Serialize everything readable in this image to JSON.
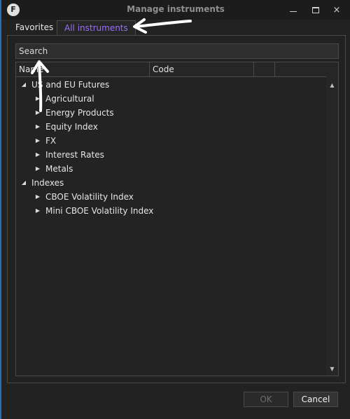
{
  "window": {
    "title": "Manage instruments",
    "controls": {
      "minimize": "minimize-icon",
      "maximize": "maximize-icon",
      "close": "×"
    }
  },
  "tabs": [
    {
      "label": "Favorites",
      "active": false
    },
    {
      "label": "All instruments",
      "active": true,
      "color": "#9b6cff"
    }
  ],
  "search": {
    "placeholder": "Search",
    "value": ""
  },
  "grid": {
    "columns": [
      "Name",
      "Code"
    ],
    "tree": [
      {
        "label": "US and EU Futures",
        "expanded": true,
        "children": [
          {
            "label": "Agricultural"
          },
          {
            "label": "Energy Products"
          },
          {
            "label": "Equity Index"
          },
          {
            "label": "FX"
          },
          {
            "label": "Interest Rates"
          },
          {
            "label": "Metals"
          }
        ]
      },
      {
        "label": "Indexes",
        "expanded": true,
        "children": [
          {
            "label": "CBOE Volatility Index"
          },
          {
            "label": "Mini CBOE Volatility Index"
          }
        ]
      }
    ]
  },
  "buttons": {
    "ok": "OK",
    "cancel": "Cancel"
  },
  "colors": {
    "accent_window_border": "#2a6fb3",
    "background": "#222222"
  }
}
